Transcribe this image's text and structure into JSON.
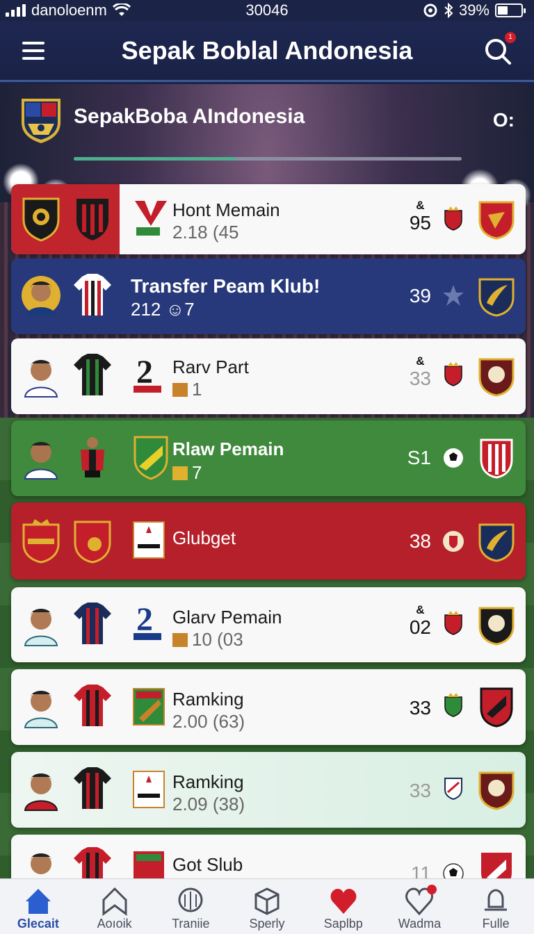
{
  "status_bar": {
    "carrier": "danoloenm",
    "time": "30046",
    "battery": "39%"
  },
  "app_bar": {
    "title": "Sepak Boblal Andonesia"
  },
  "header": {
    "title": "SepakBoba AIndonesia",
    "menu_label": "O:",
    "progress": 0.42
  },
  "cards": [
    {
      "title": "Hont Memain",
      "subtitle": "2.18 (45",
      "score_mark": "&",
      "score": "95"
    },
    {
      "title": "Transfer Peam Klub!",
      "subtitle": "212 ☺7",
      "score_mark": "",
      "score": "39"
    },
    {
      "title": "Rarv Part",
      "subtitle": "1",
      "score_mark": "&",
      "score": "33"
    },
    {
      "title": "Rlaw Pemain",
      "subtitle": "7",
      "score_mark": "",
      "score": "S1"
    },
    {
      "title": "Glubget",
      "subtitle": "",
      "score_mark": "",
      "score": "38"
    },
    {
      "title": "Glarv Pemain",
      "subtitle": "10 (03",
      "score_mark": "&",
      "score": "02"
    },
    {
      "title": "Ramking",
      "subtitle": "2.00 (63)",
      "score_mark": "",
      "score": "33"
    },
    {
      "title": "Ramking",
      "subtitle": "2.09 (38)",
      "score_mark": "",
      "score": "33"
    },
    {
      "title": "Got Slub",
      "subtitle": "",
      "score_mark": "",
      "score": "11"
    }
  ],
  "bottom_nav": [
    {
      "label": "Glecait",
      "icon": "home-icon",
      "active": true
    },
    {
      "label": "Aoıoik",
      "icon": "bookmark-icon",
      "active": false
    },
    {
      "label": "Traniie",
      "icon": "ball-icon",
      "active": false
    },
    {
      "label": "Sperly",
      "icon": "box-icon",
      "active": false
    },
    {
      "label": "Saplbp",
      "icon": "heart-icon",
      "active": false
    },
    {
      "label": "Wadma",
      "icon": "heart-outline-icon",
      "active": false
    },
    {
      "label": "Fulle",
      "icon": "bell-icon",
      "active": false
    }
  ],
  "colors": {
    "app_bar": "#1e2750",
    "accent_blue": "#2b4ea6",
    "card_navy": "#27397a",
    "card_green": "#3f8a3c",
    "card_red": "#b6202b",
    "progress_fill": "#4fae8e"
  }
}
